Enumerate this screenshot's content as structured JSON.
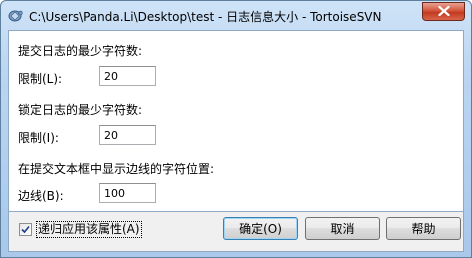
{
  "window": {
    "title": "C:\\Users\\Panda.Li\\Desktop\\test - 日志信息大小 - TortoiseSVN",
    "close_icon": "close-icon",
    "app_icon": "tortoisesvn-icon"
  },
  "log_message": {
    "section_label": "提交日志的最少字符数:",
    "field_label": "限制(L):",
    "value": "20"
  },
  "lock_message": {
    "section_label": "锁定日志的最少字符数:",
    "field_label": "限制(I):",
    "value": "20"
  },
  "border": {
    "section_label": "在提交文本框中显示边线的字符位置:",
    "field_label": "边线(B):",
    "value": "100"
  },
  "footer": {
    "recursive_label": "递归应用该属性(A)",
    "recursive_checked": true,
    "ok_label": "确定(O)",
    "cancel_label": "取消",
    "help_label": "帮助"
  }
}
